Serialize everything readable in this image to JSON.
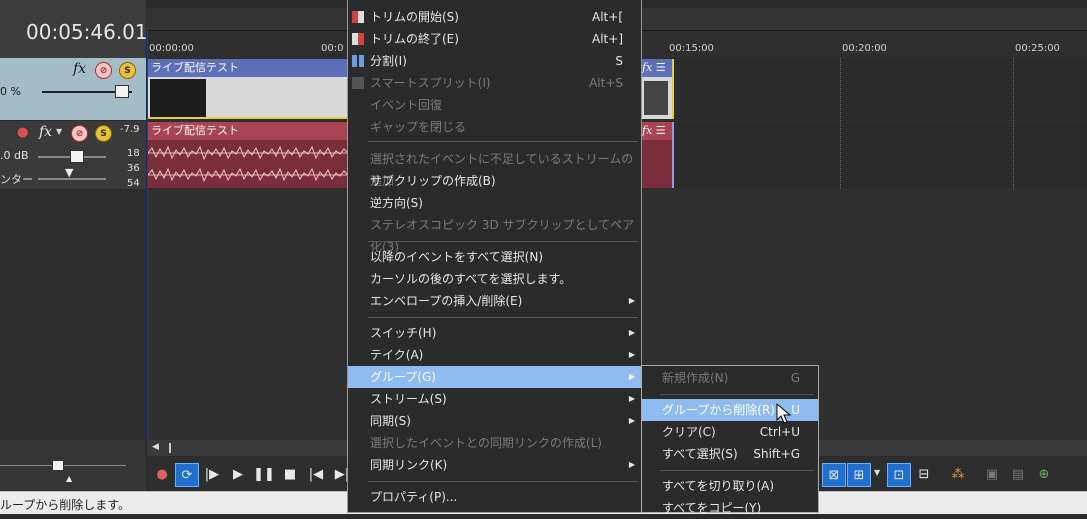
{
  "timecode": "00:05:46.01",
  "video_track": {
    "fx_label": "fx",
    "level_label": "0 %",
    "mute_glyph": "⊘",
    "solo_glyph": "S"
  },
  "audio_track": {
    "fx_label": "fx",
    "volume_label": ".0 dB",
    "pan_label": "ンター",
    "meter_labels": [
      "-7.9",
      "18",
      "36",
      "54"
    ]
  },
  "ruler": {
    "ticks": [
      "00:00:00",
      "00:0",
      "00:15:00",
      "00:20:00",
      "00:25:00"
    ]
  },
  "clips": {
    "video_title": "ライブ配信テスト",
    "audio_title": "ライブ配信テスト"
  },
  "status": {
    "text": "ループから削除します。"
  },
  "context_menu": {
    "items": [
      {
        "label": "トリムの開始(S)",
        "shortcut": "Alt+[",
        "enabled": true
      },
      {
        "label": "トリムの終了(E)",
        "shortcut": "Alt+]",
        "enabled": true
      },
      {
        "label": "分割(I)",
        "shortcut": "S",
        "enabled": true
      },
      {
        "label": "スマートスプリット(I)",
        "shortcut": "Alt+S",
        "enabled": false
      },
      {
        "label": "イベント回復",
        "shortcut": "",
        "enabled": false
      },
      {
        "label": "ギャップを閉じる",
        "shortcut": "",
        "enabled": false
      },
      {
        "label": "選択されたイベントに不足しているストリームの追加",
        "shortcut": "",
        "enabled": false
      },
      {
        "label": "サブクリップの作成(B)",
        "shortcut": "",
        "enabled": true
      },
      {
        "label": "逆方向(S)",
        "shortcut": "",
        "enabled": true
      },
      {
        "label": "ステレオスコピック 3D サブクリップとしてペア化(3)",
        "shortcut": "",
        "enabled": false
      },
      {
        "label": "以降のイベントをすべて選択(N)",
        "shortcut": "",
        "enabled": true
      },
      {
        "label": "カーソルの後のすべてを選択します。",
        "shortcut": "",
        "enabled": true
      },
      {
        "label": "エンベロープの挿入/削除(E)",
        "shortcut": "",
        "enabled": true
      },
      {
        "label": "スイッチ(H)",
        "shortcut": "",
        "enabled": true
      },
      {
        "label": "テイク(A)",
        "shortcut": "",
        "enabled": true
      },
      {
        "label": "グループ(G)",
        "shortcut": "",
        "enabled": true
      },
      {
        "label": "ストリーム(S)",
        "shortcut": "",
        "enabled": true
      },
      {
        "label": "同期(S)",
        "shortcut": "",
        "enabled": true
      },
      {
        "label": "選択したイベントとの同期リンクの作成(L)",
        "shortcut": "",
        "enabled": false
      },
      {
        "label": "同期リンク(K)",
        "shortcut": "",
        "enabled": true
      },
      {
        "label": "プロパティ(P)...",
        "shortcut": "",
        "enabled": true
      }
    ],
    "arrow_glyph": "▶"
  },
  "group_submenu": {
    "items": [
      {
        "label": "新規作成(N)",
        "shortcut": "G",
        "enabled": false
      },
      {
        "label": "グループから削除(R)",
        "shortcut": "U",
        "enabled": true
      },
      {
        "label": "クリア(C)",
        "shortcut": "Ctrl+U",
        "enabled": true
      },
      {
        "label": "すべて選択(S)",
        "shortcut": "Shift+G",
        "enabled": true
      },
      {
        "label": "すべてを切り取り(A)",
        "shortcut": "",
        "enabled": true
      },
      {
        "label": "すべてをコピー(Y)",
        "shortcut": "",
        "enabled": true
      }
    ]
  },
  "colors": {
    "highlight": "#8fbcf0",
    "video_clip": "#5d6fb8",
    "audio_clip": "#a84453",
    "video_header": "#a4bcc8"
  }
}
